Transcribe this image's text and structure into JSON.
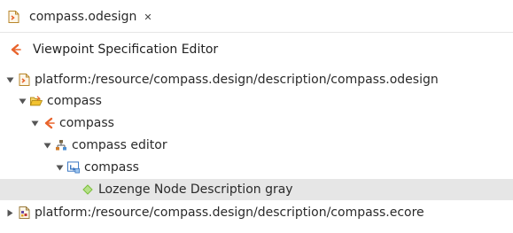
{
  "tab": {
    "title": "compass.odesign",
    "close_glyph": "✕",
    "icon": "odesign-file-icon"
  },
  "editor": {
    "title": "Viewpoint Specification Editor",
    "icon": "viewpoint-icon"
  },
  "tree": {
    "rows": [
      {
        "label": "platform:/resource/compass.design/description/compass.odesign",
        "expanded": true,
        "icon": "odesign-file-icon"
      },
      {
        "label": "compass",
        "expanded": true,
        "icon": "open-folder-icon"
      },
      {
        "label": "compass",
        "expanded": true,
        "icon": "viewpoint-icon"
      },
      {
        "label": "compass editor",
        "expanded": true,
        "icon": "diagram-description-icon"
      },
      {
        "label": "compass",
        "expanded": true,
        "icon": "default-layer-icon"
      },
      {
        "label": "Lozenge Node Description gray",
        "selected": true,
        "icon": "node-style-icon"
      },
      {
        "label": "platform:/resource/compass.design/description/compass.ecore",
        "expanded": false,
        "icon": "ecore-file-icon"
      }
    ]
  },
  "colors": {
    "viewpoint_accent": "#e8632b",
    "folder_yellow": "#f2c230",
    "link_blue": "#2f6fbf",
    "selection_gray": "#e6e6e6",
    "node_green": "#7bbf3a"
  }
}
